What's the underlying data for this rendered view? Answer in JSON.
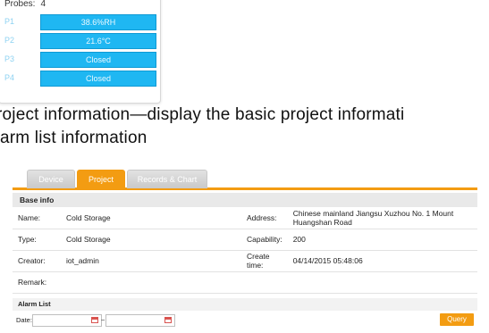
{
  "probes": {
    "label": "Probes:",
    "count": "4",
    "items": [
      {
        "id": "P1",
        "value": "38.6%RH"
      },
      {
        "id": "P2",
        "value": "21.6°C"
      },
      {
        "id": "P3",
        "value": "Closed"
      },
      {
        "id": "P4",
        "value": "Closed"
      }
    ]
  },
  "doc": {
    "line1": "roject information—display the basic project informati",
    "line2": "arm list information"
  },
  "tabs": [
    "Device",
    "Project",
    "Records & Chart"
  ],
  "base_info": {
    "title": "Base info",
    "name_label": "Name:",
    "name_value": "Cold Storage",
    "address_label": "Address:",
    "address_value": "Chinese mainland Jiangsu Xuzhou No. 1 Mount Huangshan Road",
    "type_label": "Type:",
    "type_value": "Cold Storage",
    "capability_label": "Capability:",
    "capability_value": "200",
    "creator_label": "Creator:",
    "creator_value": "iot_admin",
    "create_time_label": "Create time:",
    "create_time_value": "04/14/2015 05:48:06",
    "remark_label": "Remark:",
    "remark_value": ""
  },
  "alarm_list": {
    "title": "Alarm List",
    "date_label": "Date:",
    "separator": "~",
    "query_label": "Query"
  },
  "colors": {
    "accent": "#f39c12",
    "probe_fill": "#1fb7f2"
  }
}
